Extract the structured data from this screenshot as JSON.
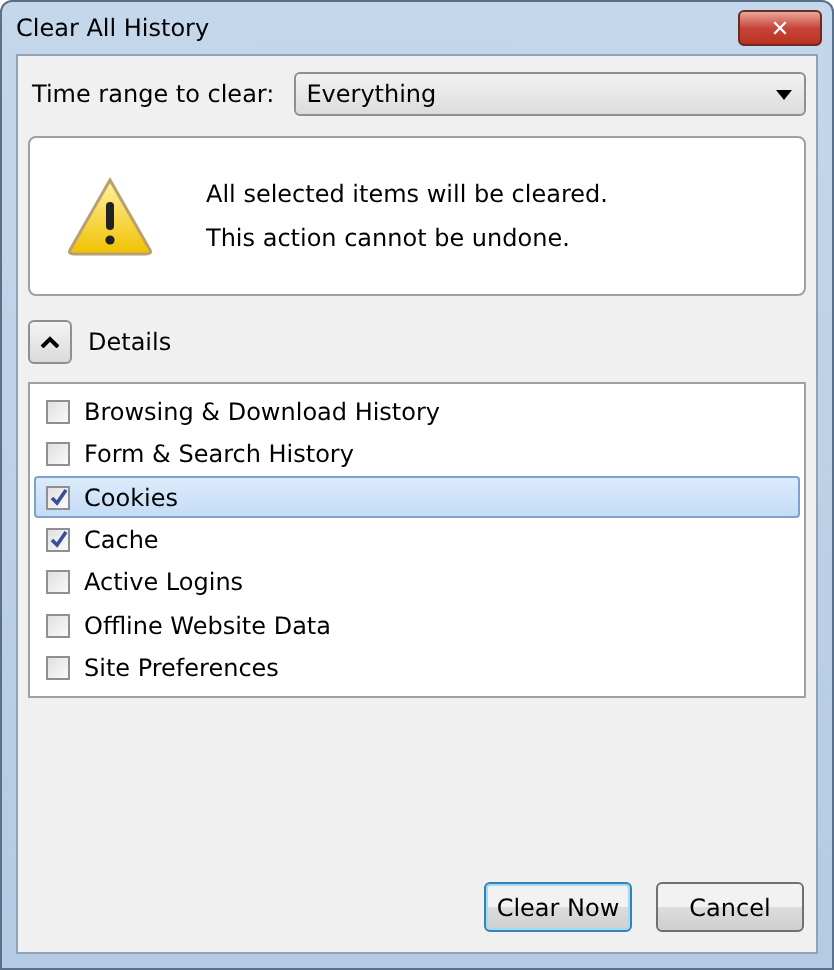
{
  "window": {
    "title": "Clear All History",
    "close": "✕"
  },
  "time_range": {
    "label": "Time range to clear:",
    "value": "Everything"
  },
  "warning": {
    "lines": [
      "All selected items will be cleared.",
      "This action cannot be undone."
    ]
  },
  "details": {
    "label": "Details",
    "expanded": true
  },
  "items": [
    {
      "label": "Browsing & Download History",
      "checked": false,
      "selected": false
    },
    {
      "label": "Form & Search History",
      "checked": false,
      "selected": false
    },
    {
      "label": "Cookies",
      "checked": true,
      "selected": true
    },
    {
      "label": "Cache",
      "checked": true,
      "selected": false
    },
    {
      "label": "Active Logins",
      "checked": false,
      "selected": false
    },
    {
      "label": "Offline Website Data",
      "checked": false,
      "selected": false
    },
    {
      "label": "Site Preferences",
      "checked": false,
      "selected": false
    }
  ],
  "buttons": [
    {
      "label": "Clear Now",
      "default": true
    },
    {
      "label": "Cancel",
      "default": false
    }
  ]
}
